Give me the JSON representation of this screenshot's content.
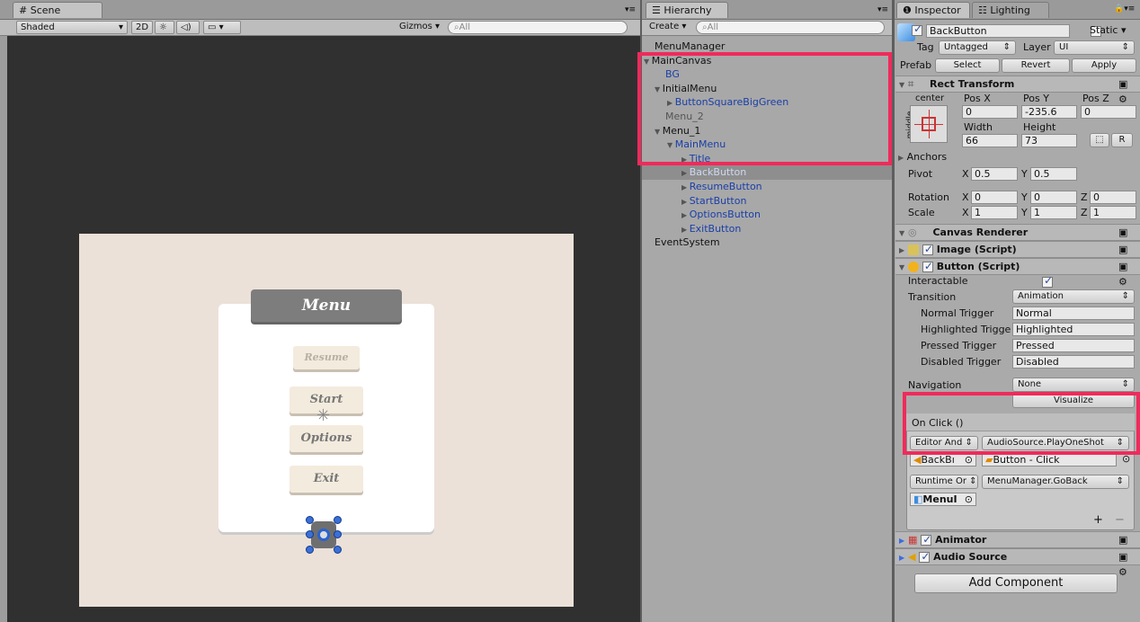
{
  "scene": {
    "tab_label": "Scene",
    "shading": "Shaded",
    "mode_2d": "2D",
    "gizmos": "Gizmos",
    "search_placeholder": "All",
    "game_menu": {
      "title": "Menu",
      "buttons": [
        "Resume",
        "Start",
        "Options",
        "Exit"
      ]
    }
  },
  "hierarchy": {
    "tab_label": "Hierarchy",
    "create": "Create",
    "search_placeholder": "All",
    "items": [
      {
        "label": "MenuManager",
        "indent": 0,
        "arrow": "",
        "color": "black"
      },
      {
        "label": "MainCanvas",
        "indent": 0,
        "arrow": "▼",
        "color": "black"
      },
      {
        "label": "BG",
        "indent": 1,
        "arrow": "",
        "color": "blue"
      },
      {
        "label": "InitialMenu",
        "indent": 1,
        "arrow": "▼",
        "color": "black"
      },
      {
        "label": "ButtonSquareBigGreen",
        "indent": 2,
        "arrow": "▶",
        "color": "blue"
      },
      {
        "label": "Menu_2",
        "indent": 1,
        "arrow": "",
        "color": "gray"
      },
      {
        "label": "Menu_1",
        "indent": 1,
        "arrow": "▼",
        "color": "black"
      },
      {
        "label": "MainMenu",
        "indent": 2,
        "arrow": "▼",
        "color": "blue"
      },
      {
        "label": "Title",
        "indent": 3,
        "arrow": "▶",
        "color": "blue"
      },
      {
        "label": "BackButton",
        "indent": 3,
        "arrow": "▶",
        "color": "selected"
      },
      {
        "label": "ResumeButton",
        "indent": 3,
        "arrow": "▶",
        "color": "blue"
      },
      {
        "label": "StartButton",
        "indent": 3,
        "arrow": "▶",
        "color": "blue"
      },
      {
        "label": "OptionsButton",
        "indent": 3,
        "arrow": "▶",
        "color": "blue"
      },
      {
        "label": "ExitButton",
        "indent": 3,
        "arrow": "▶",
        "color": "blue"
      },
      {
        "label": "EventSystem",
        "indent": 0,
        "arrow": "",
        "color": "black"
      }
    ]
  },
  "inspector": {
    "tab_label": "Inspector",
    "lighting_tab": "Lighting",
    "object_name": "BackButton",
    "static_label": "Static",
    "tag_label": "Tag",
    "tag_value": "Untagged",
    "layer_label": "Layer",
    "layer_value": "UI",
    "prefab_label": "Prefab",
    "select": "Select",
    "revert": "Revert",
    "apply": "Apply",
    "rect_transform": {
      "title": "Rect Transform",
      "anchor_h": "center",
      "anchor_v": "middle",
      "pos_x_label": "Pos X",
      "pos_y_label": "Pos Y",
      "pos_z_label": "Pos Z",
      "pos_x": "0",
      "pos_y": "-235.6",
      "pos_z": "0",
      "width_label": "Width",
      "height_label": "Height",
      "width": "66",
      "height": "73",
      "r_btn": "R",
      "anchors": "Anchors",
      "pivot_label": "Pivot",
      "pivot_x": "0.5",
      "pivot_y": "0.5",
      "rotation_label": "Rotation",
      "rot_x": "0",
      "rot_y": "0",
      "rot_z": "0",
      "scale_label": "Scale",
      "scale_x": "1",
      "scale_y": "1",
      "scale_z": "1",
      "x": "X",
      "y": "Y",
      "z": "Z"
    },
    "canvas_renderer": "Canvas Renderer",
    "image_script": "Image (Script)",
    "button_script": {
      "title": "Button (Script)",
      "interactable_label": "Interactable",
      "transition_label": "Transition",
      "transition_value": "Animation",
      "normal_trigger_label": "Normal Trigger",
      "normal_trigger": "Normal",
      "highlighted_trigger_label": "Highlighted Trigge",
      "highlighted_trigger": "Highlighted",
      "pressed_trigger_label": "Pressed Trigger",
      "pressed_trigger": "Pressed",
      "disabled_trigger_label": "Disabled Trigger",
      "disabled_trigger": "Disabled",
      "navigation_label": "Navigation",
      "navigation_value": "None",
      "visualize": "Visualize",
      "on_click": "On Click ()",
      "event1_mode": "Editor And",
      "event1_func": "AudioSource.PlayOneShot",
      "event1_obj": "BackBı",
      "event1_arg": "Button - Click",
      "event2_mode": "Runtime Or",
      "event2_func": "MenuManager.GoBack",
      "event2_obj": "MenuI",
      "plus": "+",
      "minus": "−"
    },
    "animator": "Animator",
    "audio_source": "Audio Source",
    "add_component": "Add Component"
  },
  "colors": {
    "highlight": "#f02a5b",
    "selection": "#8e8e8e"
  }
}
